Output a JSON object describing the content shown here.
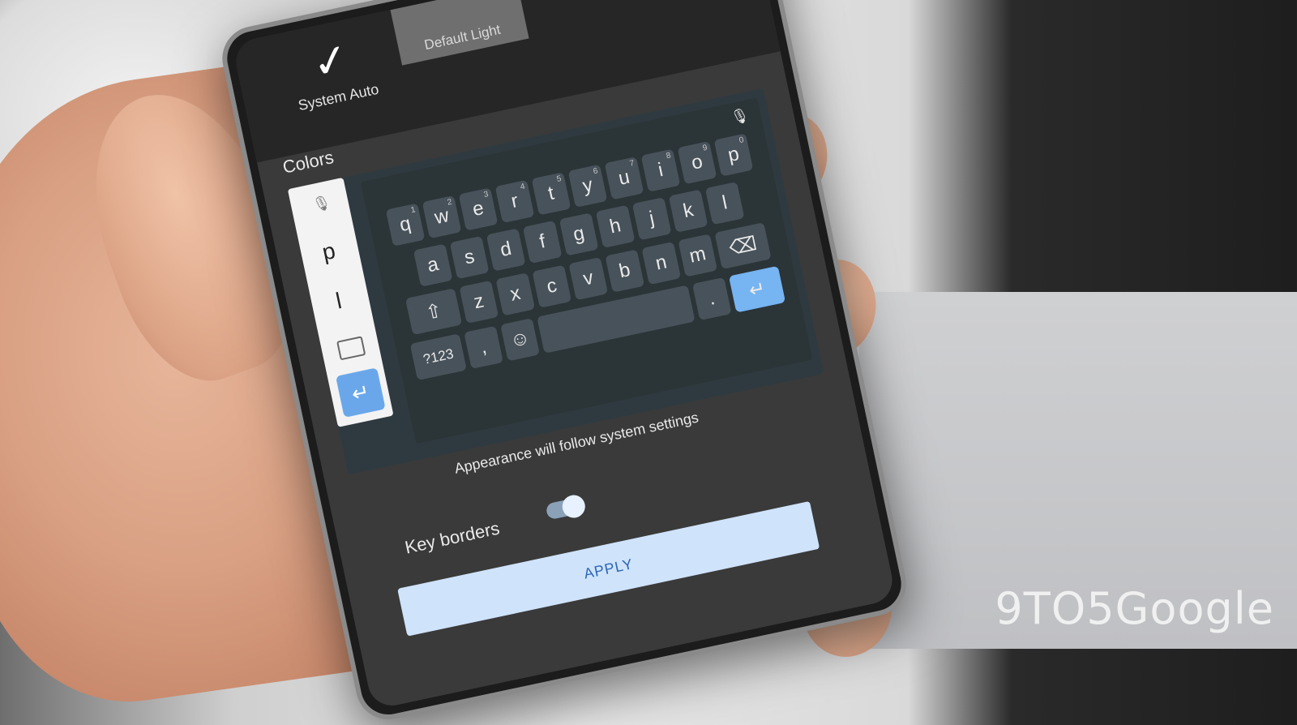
{
  "settings": {
    "theme": {
      "selected_label": "System Auto",
      "other_label": "Default Light"
    },
    "section_title": "Colors",
    "appearance_note": "Appearance will follow system settings",
    "key_borders_label": "Key borders",
    "key_borders_enabled": true,
    "apply_label": "APPLY"
  },
  "keyboard_preview": {
    "strip": {
      "p": "p",
      "l": "l"
    },
    "rows": [
      [
        {
          "k": "q",
          "n": "1"
        },
        {
          "k": "w",
          "n": "2"
        },
        {
          "k": "e",
          "n": "3"
        },
        {
          "k": "r",
          "n": "4"
        },
        {
          "k": "t",
          "n": "5"
        },
        {
          "k": "y",
          "n": "6"
        },
        {
          "k": "u",
          "n": "7"
        },
        {
          "k": "i",
          "n": "8"
        },
        {
          "k": "o",
          "n": "9"
        },
        {
          "k": "p",
          "n": "0"
        }
      ],
      [
        {
          "k": "a"
        },
        {
          "k": "s"
        },
        {
          "k": "d"
        },
        {
          "k": "f"
        },
        {
          "k": "g"
        },
        {
          "k": "h"
        },
        {
          "k": "j"
        },
        {
          "k": "k"
        },
        {
          "k": "l"
        }
      ],
      [
        {
          "k": "z"
        },
        {
          "k": "x"
        },
        {
          "k": "c"
        },
        {
          "k": "v"
        },
        {
          "k": "b"
        },
        {
          "k": "n"
        },
        {
          "k": "m"
        }
      ]
    ],
    "symbols_label": "?123",
    "comma_label": ",",
    "period_label": "."
  },
  "watermark": "9TO5Google"
}
